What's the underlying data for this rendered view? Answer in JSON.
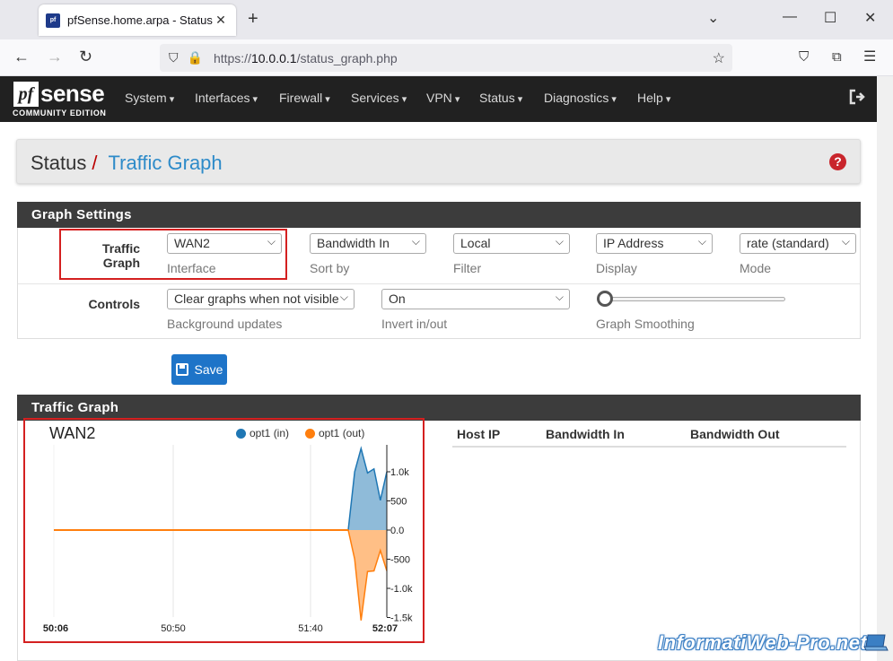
{
  "browser": {
    "tab_title": "pfSense.home.arpa - Status: Tra",
    "favicon_text": "pf",
    "url_prefix": "https://",
    "url_host": "10.0.0.1",
    "url_path": "/status_graph.php"
  },
  "pfsense": {
    "logo_pf": "pf",
    "logo_sense": "sense",
    "logo_edition": "COMMUNITY EDITION",
    "menu": [
      "System",
      "Interfaces",
      "Firewall",
      "Services",
      "VPN",
      "Status",
      "Diagnostics",
      "Help"
    ]
  },
  "breadcrumb": {
    "section": "Status",
    "separator": "/",
    "page": "Traffic Graph",
    "help_icon": "?"
  },
  "graph_settings": {
    "title": "Graph Settings",
    "row1_label": "Traffic Graph",
    "interface": {
      "value": "WAN2",
      "help": "Interface"
    },
    "sort_by": {
      "value": "Bandwidth In",
      "help": "Sort by"
    },
    "filter": {
      "value": "Local",
      "help": "Filter"
    },
    "display": {
      "value": "IP Address",
      "help": "Display"
    },
    "mode": {
      "value": "rate (standard)",
      "help": "Mode"
    },
    "row2_label": "Controls",
    "background_updates": {
      "value": "Clear graphs when not visible",
      "help": "Background updates"
    },
    "invert": {
      "value": "On",
      "help": "Invert in/out"
    },
    "smoothing": {
      "value": 0,
      "help": "Graph Smoothing"
    },
    "save_label": "Save"
  },
  "traffic_graph": {
    "title": "Traffic Graph",
    "interface_title": "WAN2",
    "legend_in": "opt1 (in)",
    "legend_out": "opt1 (out)",
    "colors": {
      "in": "#1f77b4",
      "out": "#ff7f0e"
    },
    "table_headers": [
      "Host IP",
      "Bandwidth In",
      "Bandwidth Out"
    ]
  },
  "chart_data": {
    "type": "area",
    "title": "WAN2",
    "x": [
      "50:06",
      "50:50",
      "51:40",
      "52:07"
    ],
    "y_ticks": [
      "1.0k",
      "500",
      "0.0",
      "-500",
      "-1.0k",
      "-1.5k"
    ],
    "ylim": [
      -1500,
      1400
    ],
    "grid": true,
    "legend_position": "top",
    "series": [
      {
        "name": "opt1 (in)",
        "values": [
          0,
          0,
          0,
          0,
          0,
          0,
          0,
          0,
          1000,
          1400,
          980,
          1050,
          510,
          1000
        ]
      },
      {
        "name": "opt1 (out)",
        "values": [
          0,
          0,
          0,
          0,
          0,
          0,
          0,
          0,
          -500,
          -1550,
          -710,
          -700,
          -350,
          -700
        ]
      }
    ]
  },
  "watermark": "InformatiWeb-Pro.net"
}
